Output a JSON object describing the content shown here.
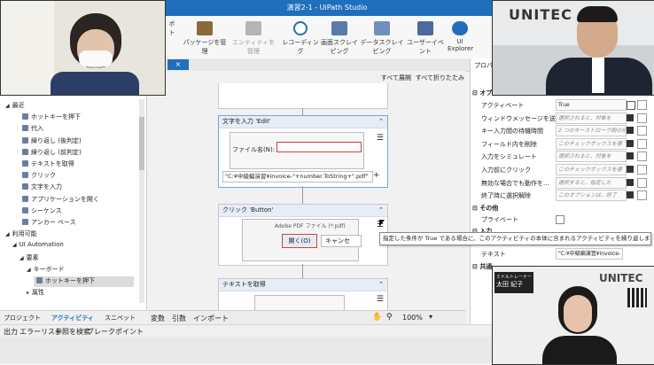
{
  "window": {
    "title": "演習2-1 - UiPath Studio"
  },
  "ribbon": {
    "items": [
      {
        "label": "パッケージを管理"
      },
      {
        "label": "エンティティを管理"
      },
      {
        "label": "レコーディング"
      },
      {
        "label": "画面スクレイピング"
      },
      {
        "label": "データスクレイピング"
      },
      {
        "label": "ユーザーイベント"
      },
      {
        "label": "UI Explorer"
      }
    ],
    "cut_label": "ボト"
  },
  "doc_tab": {
    "close": "×"
  },
  "canvas_toolbar": {
    "expand_all": "すべて展開",
    "collapse_all": "すべて折りたたみ"
  },
  "activities_panel": {
    "items": [
      {
        "label": "最近",
        "indent": 0,
        "arrow": "◢"
      },
      {
        "label": "ホットキーを押下",
        "indent": 2,
        "arrow": ""
      },
      {
        "label": "代入",
        "indent": 2,
        "arrow": ""
      },
      {
        "label": "繰り返し (後判定)",
        "indent": 2,
        "arrow": ""
      },
      {
        "label": "繰り返し (前判定)",
        "indent": 2,
        "arrow": ""
      },
      {
        "label": "テキストを取得",
        "indent": 2,
        "arrow": ""
      },
      {
        "label": "クリック",
        "indent": 2,
        "arrow": ""
      },
      {
        "label": "文字を入力",
        "indent": 2,
        "arrow": ""
      },
      {
        "label": "アプリケーションを開く",
        "indent": 2,
        "arrow": ""
      },
      {
        "label": "シーケンス",
        "indent": 2,
        "arrow": ""
      },
      {
        "label": "アンカー ベース",
        "indent": 2,
        "arrow": ""
      },
      {
        "label": "利用可能",
        "indent": 0,
        "arrow": "◢"
      },
      {
        "label": "UI Automation",
        "indent": 1,
        "arrow": "◢"
      },
      {
        "label": "要素",
        "indent": 2,
        "arrow": "◢"
      },
      {
        "label": "キーボード",
        "indent": 3,
        "arrow": "◢"
      },
      {
        "label": "ホットキーを押下",
        "indent": 4,
        "arrow": ""
      },
      {
        "label": "属性",
        "indent": 3,
        "arrow": "▸"
      }
    ]
  },
  "bottom_tabs": {
    "project": "プロジェクト",
    "activities": "アクティビティ",
    "snippets": "スニペット"
  },
  "output_bar": {
    "items": [
      "出力",
      "エラーリスト",
      "参照を検索",
      "ブレークポイント"
    ]
  },
  "zoom_bar": {
    "variables": "変数",
    "arguments": "引数",
    "imports": "インポート",
    "zoom": "100%"
  },
  "workflow": {
    "type_into": {
      "title": "文字を入力 'Edit'",
      "field_label": "ファイル名(N):",
      "expression": "\"C:¥中級編演習¥invoice-\"+number.ToString+\".pdf\""
    },
    "click": {
      "title": "クリック 'Button'",
      "adobe_label": "Adobe PDF ファイル (*.pdf)",
      "open_btn": "開く(O)",
      "cancel_btn": "キャンセ"
    },
    "get_text": {
      "title": "テキストを取得"
    }
  },
  "tooltip": {
    "text": "指定した条件が True である場合に、このアクティビティの本体に含まれるアクティビティを繰り返します。(While)"
  },
  "properties_panel": {
    "title": "プロパ",
    "section_options": "オプション",
    "rows": [
      {
        "label": "アクティベート",
        "value": "True"
      },
      {
        "label": "ウィンドウメッセージを送信",
        "value": "選択されると、対象を"
      },
      {
        "label": "キー入力間の待機時間",
        "value": "2 つのキーストローク間の待"
      },
      {
        "label": "フィールド内を削除",
        "value": "このチェックボックスを選"
      },
      {
        "label": "入力をシミュレート",
        "value": "選択されると、対象を"
      },
      {
        "label": "入力前にクリック",
        "value": "このチェックボックスを選"
      },
      {
        "label": "無効な場合でも動作を...",
        "value": "選択すると、指定した"
      },
      {
        "label": "終了時に選択解除",
        "value": "このオプションは、終了"
      }
    ],
    "section_other": "その他",
    "private_label": "プライベート",
    "section_input": "入力",
    "text_label": "テキスト",
    "text_value": "\"C:¥中級編演習¥invoice-",
    "section_common": "共通"
  },
  "videos": {
    "brand": "UNITEC",
    "caption_role": "ミドルトレーナー",
    "caption_name": "太田 紀子"
  },
  "colors": {
    "accent": "#1f6fbd",
    "activity_header": "#e6edf6",
    "selection_red": "#d04040"
  }
}
